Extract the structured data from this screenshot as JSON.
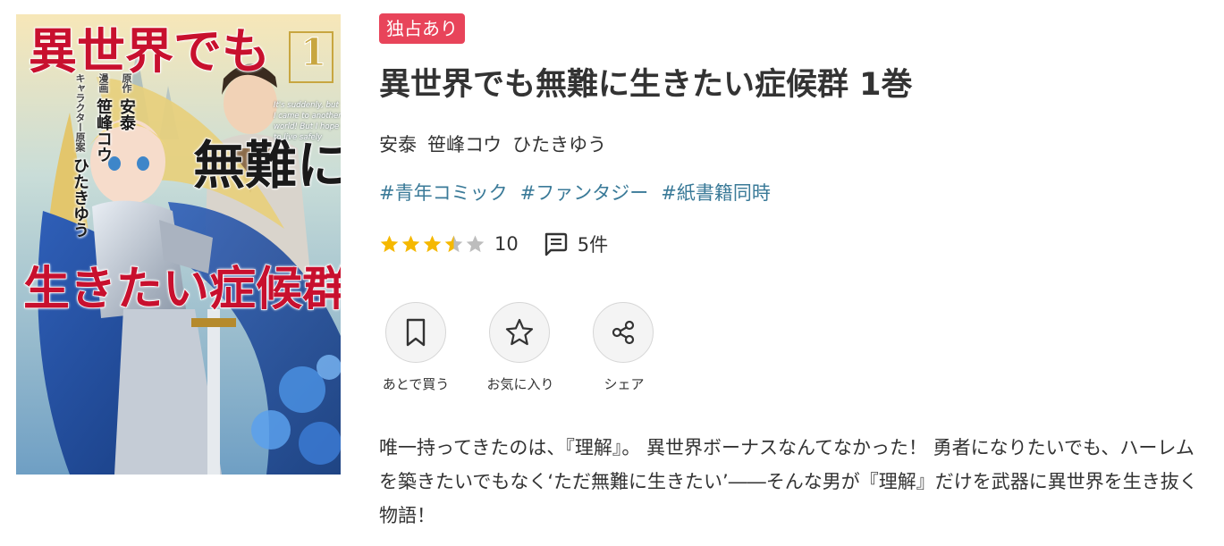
{
  "cover": {
    "title_line1": "異世界でも",
    "title_line2": "無難に",
    "title_line3": "生きたい症候群",
    "volume_number": "1",
    "english_subtitle": "It's suddenly, but I came to another world! But I hope to live safely",
    "credits": [
      {
        "role": "原作",
        "name": "安泰"
      },
      {
        "role": "漫画",
        "name": "笹峰コウ"
      },
      {
        "role": "キャラクター原案",
        "name": "ひたきゆう"
      }
    ]
  },
  "badge": "独占あり",
  "title": "異世界でも無難に生きたい症候群 1巻",
  "authors": [
    "安泰",
    "笹峰コウ",
    "ひたきゆう"
  ],
  "tags": [
    "#青年コミック",
    "#ファンタジー",
    "#紙書籍同時"
  ],
  "rating": {
    "value": 3.5,
    "max": 5,
    "count": "10",
    "star_color": "#f5b800",
    "empty_star_color": "#bdbdbd"
  },
  "reviews": {
    "count": "5件",
    "icon": "comment-icon"
  },
  "actions": [
    {
      "label": "あとで買う",
      "icon": "bookmark-icon"
    },
    {
      "label": "お気に入り",
      "icon": "star-outline-icon"
    },
    {
      "label": "シェア",
      "icon": "share-icon"
    }
  ],
  "description": "唯一持ってきたのは、『理解』。 異世界ボーナスなんてなかった！ 勇者になりたいでも、ハーレムを築きたいでもなく‘ただ無難に生きたい’――そんな男が『理解』だけを武器に異世界を生き抜く物語！",
  "colors": {
    "badge": "#e8445a",
    "tag": "#3a7a98",
    "text": "#333333"
  }
}
